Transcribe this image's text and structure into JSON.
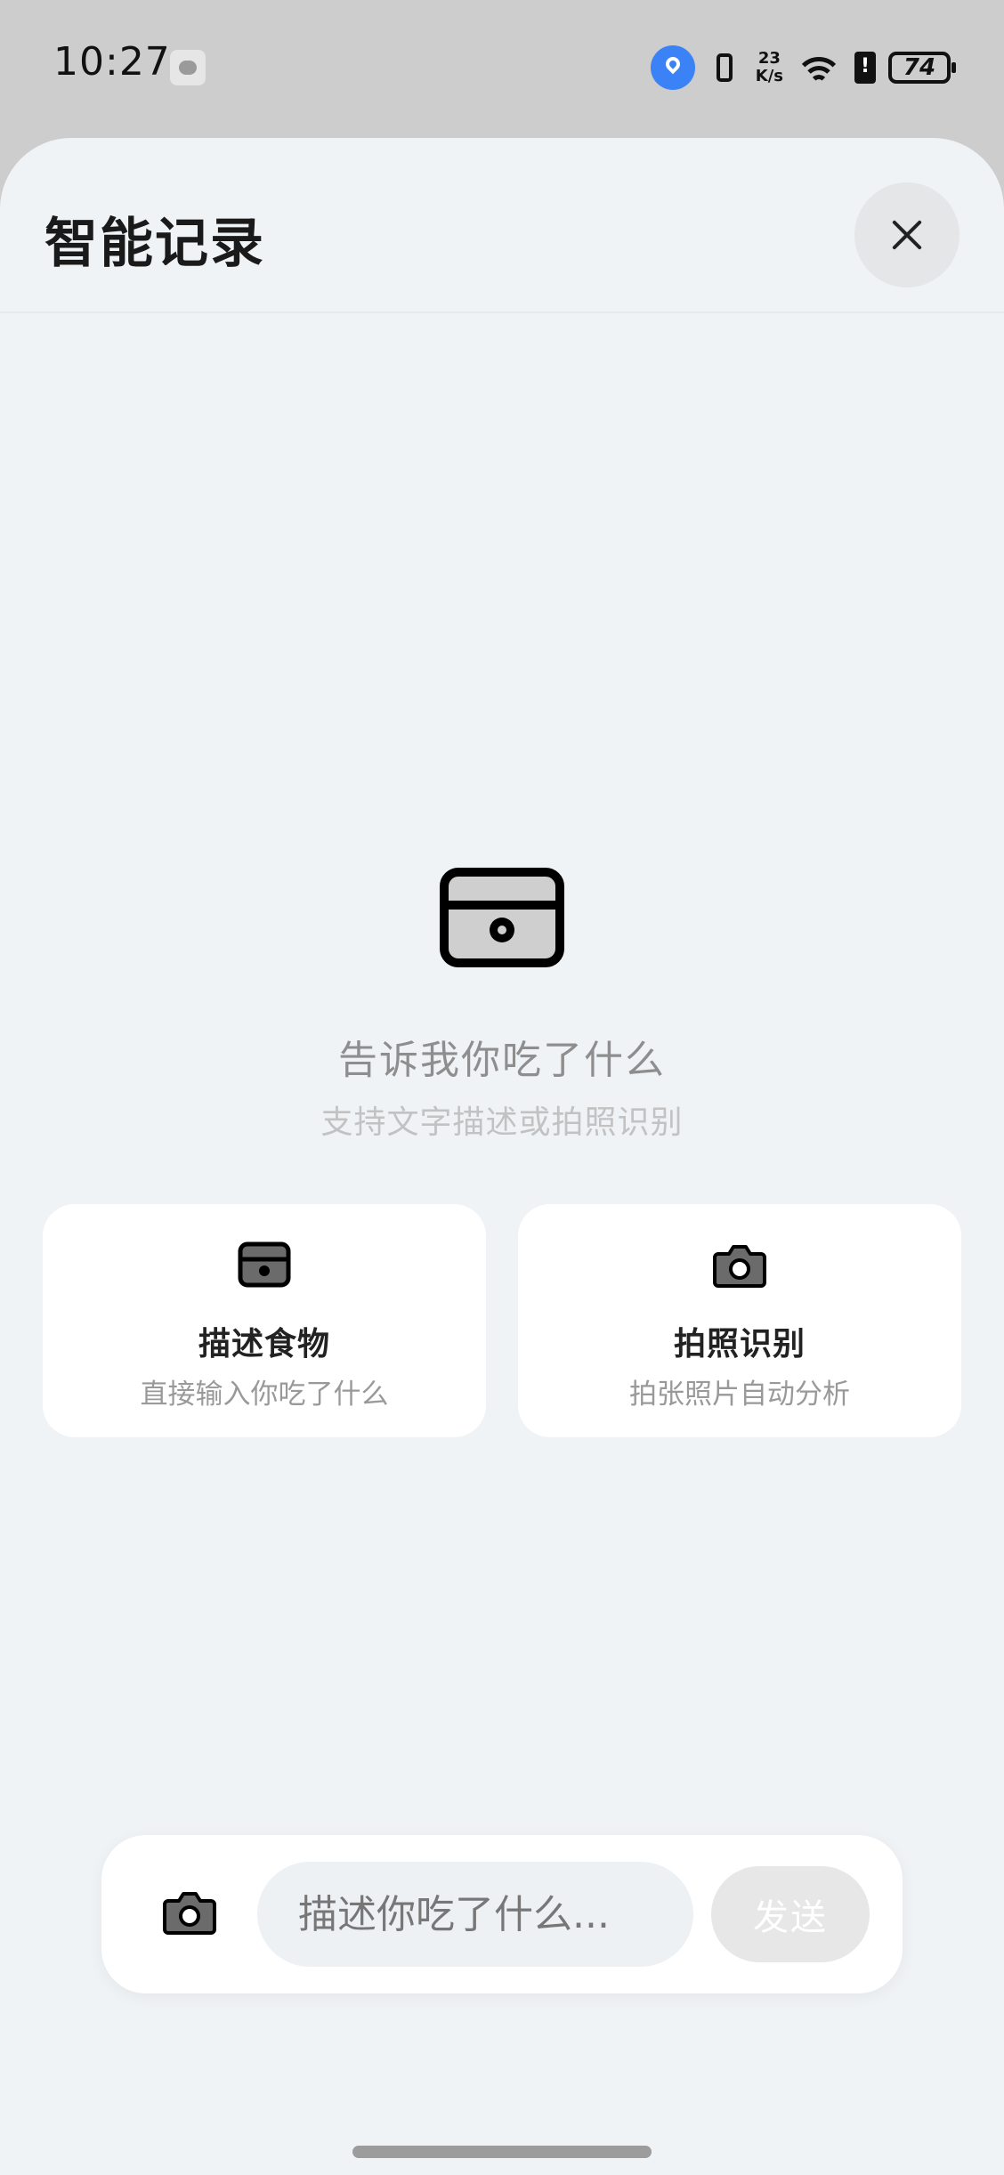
{
  "status_bar": {
    "time": "10:27",
    "net_speed_value": "23",
    "net_speed_unit": "K/s",
    "battery": "74"
  },
  "sheet": {
    "title": "智能记录"
  },
  "empty_state": {
    "icon": "wallet-icon",
    "title": "告诉我你吃了什么",
    "subtitle": "支持文字描述或拍照识别"
  },
  "options": [
    {
      "icon": "wallet-icon",
      "title": "描述食物",
      "subtitle": "直接输入你吃了什么"
    },
    {
      "icon": "camera-icon",
      "title": "拍照识别",
      "subtitle": "拍张照片自动分析"
    }
  ],
  "input_bar": {
    "placeholder": "描述你吃了什么...",
    "send_label": "发送"
  },
  "colors": {
    "sheet_background": "#f0f3f6",
    "status_background": "#cdcdcd",
    "location_badge": "#3b82f6",
    "send_disabled": "#e7e7e7"
  }
}
